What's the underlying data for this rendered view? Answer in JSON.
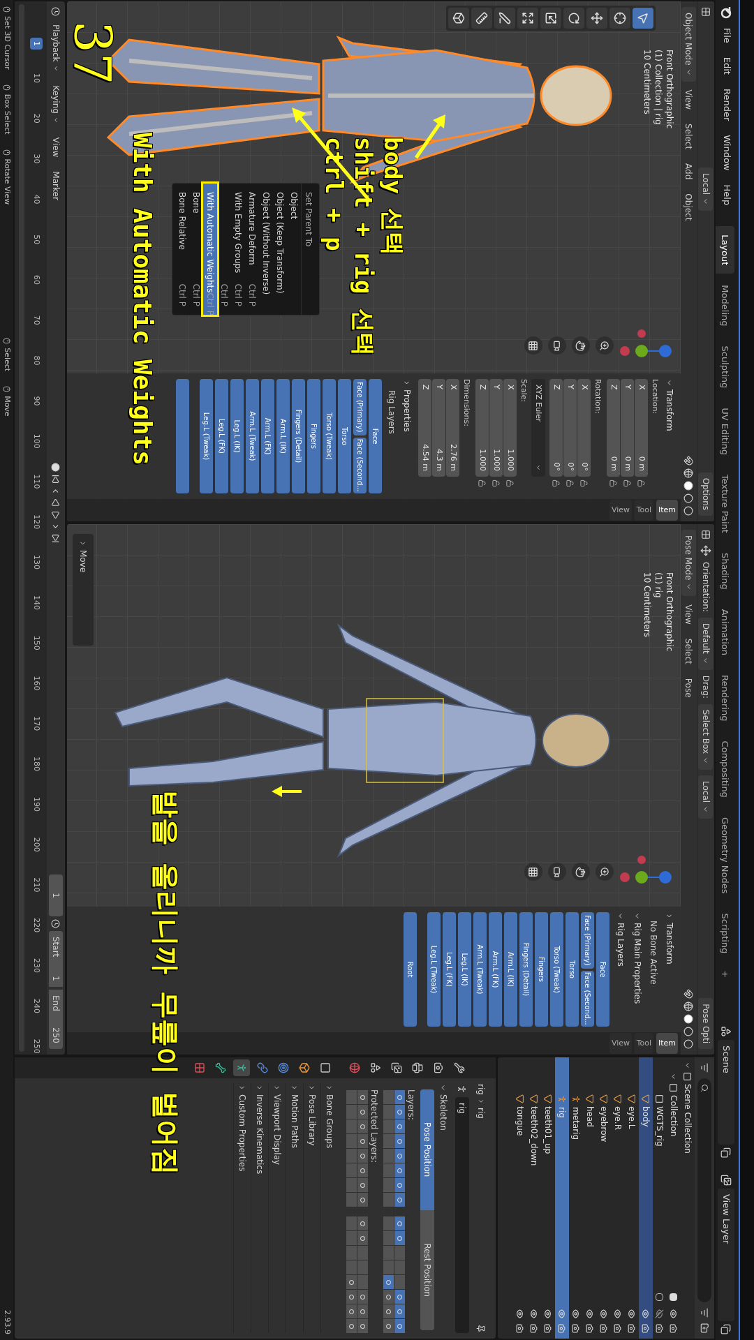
{
  "topbar": {
    "menus": [
      "File",
      "Edit",
      "Render",
      "Window",
      "Help"
    ],
    "workspaces": [
      {
        "label": "Layout",
        "selected": true
      },
      {
        "label": "Modeling",
        "selected": false
      },
      {
        "label": "Sculpting",
        "selected": false
      },
      {
        "label": "UV Editing",
        "selected": false
      },
      {
        "label": "Texture Paint",
        "selected": false
      },
      {
        "label": "Shading",
        "selected": false
      },
      {
        "label": "Animation",
        "selected": false
      },
      {
        "label": "Rendering",
        "selected": false
      },
      {
        "label": "Compositing",
        "selected": false
      },
      {
        "label": "Geometry Nodes",
        "selected": false
      },
      {
        "label": "Scripting",
        "selected": false
      }
    ],
    "add_workspace": "+",
    "scene": "Scene",
    "view_layer": "View Layer"
  },
  "viewports": [
    {
      "kind": "object",
      "tool_header": [
        {
          "kind": "dropdown",
          "text": "Local"
        },
        {
          "kind": "options",
          "text": "Options"
        }
      ],
      "mode": "Object Mode",
      "menus": [
        "View",
        "Select",
        "Add",
        "Object"
      ],
      "overlay": [
        "Front Orthographic",
        "(1) Collection | rig",
        "10 Centimeters"
      ],
      "toolbar": [
        {
          "kind": "select",
          "selected": true
        },
        {
          "kind": "cursor",
          "selected": false
        },
        {
          "kind": "move",
          "selected": false
        },
        {
          "kind": "rotate",
          "selected": false
        },
        {
          "kind": "scale",
          "selected": false
        },
        {
          "kind": "transform",
          "selected": false
        },
        {
          "kind": "annotate",
          "selected": false
        },
        {
          "kind": "measure",
          "selected": false
        },
        {
          "kind": "add_cube",
          "selected": false
        }
      ],
      "sidebar": {
        "tabs": [
          {
            "label": "View",
            "selected": false
          },
          {
            "label": "Tool",
            "selected": false
          },
          {
            "label": "Item",
            "selected": true
          }
        ],
        "sections": [
          {
            "kind": "header",
            "label": "Transform",
            "expanded": true
          },
          {
            "kind": "vector",
            "label": "Location:",
            "locks": true,
            "fields": [
              {
                "axis": "X",
                "value": "0 m"
              },
              {
                "axis": "Y",
                "value": "0 m"
              },
              {
                "axis": "Z",
                "value": "0 m"
              }
            ]
          },
          {
            "kind": "vector",
            "label": "Rotation:",
            "locks": true,
            "fields": [
              {
                "axis": "X",
                "value": "0°"
              },
              {
                "axis": "Y",
                "value": "0°"
              },
              {
                "axis": "Z",
                "value": "0°"
              }
            ]
          },
          {
            "kind": "dropdown",
            "value": "XYZ Euler"
          },
          {
            "kind": "vector",
            "label": "Scale:",
            "locks": true,
            "fields": [
              {
                "axis": "X",
                "value": "1.000"
              },
              {
                "axis": "Y",
                "value": "1.000"
              },
              {
                "axis": "Z",
                "value": "1.000"
              }
            ]
          },
          {
            "kind": "vector",
            "label": "Dimensions:",
            "locks": false,
            "fields": [
              {
                "axis": "X",
                "value": "2.76 m"
              },
              {
                "axis": "Y",
                "value": "4.3 m"
              },
              {
                "axis": "Z",
                "value": "4.54 m"
              }
            ]
          },
          {
            "kind": "header",
            "label": "Properties",
            "expanded": false
          },
          {
            "kind": "subheader",
            "label": "Rig Layers"
          },
          {
            "kind": "layers",
            "buttons": [
              {
                "label": "Face",
                "on": true,
                "half": false
              },
              {
                "label": "Face (Primary)",
                "on": true,
                "half": true
              },
              {
                "label": "Face (Second...",
                "on": true,
                "half": true
              },
              {
                "label": "Torso",
                "on": true,
                "half": false
              },
              {
                "label": "Torso (Tweak)",
                "on": true,
                "half": false
              },
              {
                "label": "Fingers",
                "on": true,
                "half": false
              },
              {
                "label": "Fingers (Detail)",
                "on": true,
                "half": false
              },
              {
                "label": "Arm.L (IK)",
                "on": true,
                "half": false
              },
              {
                "label": "Arm.L (FK)",
                "on": true,
                "half": false
              },
              {
                "label": "Arm.L (Tweak)",
                "on": true,
                "half": false
              },
              {
                "label": "Leg.L (IK)",
                "on": true,
                "half": false
              },
              {
                "label": "Leg.L (FK)",
                "on": true,
                "half": false
              },
              {
                "label": "Leg.L (Tweak)",
                "on": true,
                "half": false
              },
              {
                "on": true,
                "half": false
              }
            ]
          }
        ]
      }
    },
    {
      "kind": "pose",
      "tool_header": [
        {
          "kind": "label",
          "text": "Orientation:"
        },
        {
          "kind": "dropdown",
          "text": "Default"
        },
        {
          "kind": "label",
          "text": "Drag:"
        },
        {
          "kind": "dropdown",
          "text": "Select Box"
        },
        {
          "kind": "dropdown",
          "text": "Local"
        },
        {
          "kind": "options",
          "text": "Pose Opti"
        }
      ],
      "mode": "Pose Mode",
      "menus": [
        "View",
        "Select",
        "Pose"
      ],
      "overlay": [
        "Front Orthographic",
        "(1) rig",
        "10 Centimeters"
      ],
      "redo_panel": "Move",
      "sidebar": {
        "tabs": [
          {
            "label": "View",
            "selected": false
          },
          {
            "label": "Tool",
            "selected": false
          },
          {
            "label": "Item",
            "selected": true
          }
        ],
        "sections": [
          {
            "kind": "header",
            "label": "Transform",
            "expanded": false
          },
          {
            "kind": "text",
            "label": "No Bone Active"
          },
          {
            "kind": "header",
            "label": "Rig Main Properties",
            "expanded": true
          },
          {
            "kind": "header",
            "label": "Rig Layers",
            "expanded": true
          },
          {
            "kind": "layers",
            "buttons": [
              {
                "label": "Face",
                "on": true,
                "half": false
              },
              {
                "label": "Face (Primary)",
                "on": true,
                "half": true
              },
              {
                "label": "Face (Second...",
                "on": true,
                "half": true
              },
              {
                "label": "Torso",
                "on": true,
                "half": false
              },
              {
                "label": "Torso (Tweak)",
                "on": true,
                "half": false
              },
              {
                "label": "Fingers",
                "on": true,
                "half": false
              },
              {
                "label": "Fingers (Detail)",
                "on": true,
                "half": false
              },
              {
                "label": "Arm.L (IK)",
                "on": true,
                "half": false
              },
              {
                "label": "Arm.L (FK)",
                "on": true,
                "half": false
              },
              {
                "label": "Arm.L (Tweak)",
                "on": true,
                "half": false
              },
              {
                "label": "Leg.L (IK)",
                "on": true,
                "half": false
              },
              {
                "label": "Leg.L (FK)",
                "on": true,
                "half": false
              },
              {
                "label": "Leg.L (Tweak)",
                "on": true,
                "half": false
              },
              {
                "label": "Root",
                "on": true,
                "half": false
              }
            ]
          }
        ]
      }
    }
  ],
  "parent_menu": {
    "title": "Set Parent To",
    "items": [
      {
        "label": "Object",
        "selected": false
      },
      {
        "label": "Object (Keep Transform)",
        "selected": false
      },
      {
        "label": "Object (Without Inverse)",
        "selected": false
      },
      {
        "label": "Armature Deform",
        "shortcut": "Ctrl P",
        "selected": false
      },
      {
        "label": "With Empty Groups",
        "shortcut": "Ctrl P",
        "selected": false
      },
      {
        "shortcut": "Ctrl P",
        "selected": false
      },
      {
        "label": "With Automatic Weights",
        "shortcut": "Ctrl P",
        "selected": true,
        "outlined": true
      },
      {
        "label": "Bone",
        "shortcut": "Ctrl P",
        "selected": false
      },
      {
        "label": "Bone Relative",
        "shortcut": "Ctrl P",
        "selected": false
      }
    ]
  },
  "outliner": {
    "tree": [
      {
        "name": "Scene Collection",
        "kind": "scene_collection",
        "expanded": true,
        "selected": false,
        "children": [
          {
            "name": "Collection",
            "kind": "collection",
            "expanded": true,
            "checked": true,
            "visible": true,
            "selected": false,
            "children": [
              {
                "name": "WGTS_rig",
                "kind": "collection",
                "checked": false,
                "visible": false,
                "selected": false
              },
              {
                "name": "body",
                "kind": "mesh",
                "visible": true,
                "selected": true,
                "active": false
              },
              {
                "name": "eye.L",
                "kind": "mesh",
                "visible": true,
                "selected": false,
                "active": false
              },
              {
                "name": "eye.R",
                "kind": "mesh",
                "visible": true,
                "selected": false,
                "active": false
              },
              {
                "name": "eyebrow",
                "kind": "mesh",
                "visible": true,
                "selected": false,
                "active": false
              },
              {
                "name": "head",
                "kind": "mesh",
                "visible": true,
                "selected": false,
                "active": false
              },
              {
                "name": "metarig",
                "kind": "armature",
                "visible": true,
                "selected": false,
                "active": false
              },
              {
                "name": "rig",
                "kind": "armature",
                "visible": true,
                "selected": true,
                "active": true
              },
              {
                "name": "teeth01_up",
                "kind": "mesh",
                "visible": true,
                "selected": false,
                "active": false
              },
              {
                "name": "teeth02_down",
                "kind": "mesh",
                "visible": true,
                "selected": false,
                "active": false
              },
              {
                "name": "tongue",
                "kind": "mesh",
                "visible": true,
                "selected": false,
                "active": false
              }
            ]
          }
        ]
      }
    ]
  },
  "properties": {
    "tabs": [
      {
        "kind": "tool",
        "selected": false
      },
      {
        "kind": "render",
        "selected": false
      },
      {
        "kind": "output",
        "selected": false
      },
      {
        "kind": "view_layer",
        "selected": false
      },
      {
        "kind": "scene",
        "selected": false
      },
      {
        "kind": "world",
        "selected": false
      },
      {
        "kind": "collection",
        "selected": false
      },
      {
        "kind": "object",
        "selected": false
      },
      {
        "kind": "physics",
        "selected": false
      },
      {
        "kind": "constraints",
        "selected": false
      },
      {
        "kind": "armature",
        "selected": true
      },
      {
        "kind": "bone",
        "selected": false
      },
      {
        "kind": "texture",
        "selected": false
      }
    ],
    "breadcrumb": [
      "rig",
      "rig"
    ],
    "name": "rig",
    "skeleton": {
      "title": "Skeleton",
      "expanded": true,
      "positions": [
        {
          "label": "Pose Position",
          "selected": true
        },
        {
          "label": "Rest Position",
          "selected": false
        }
      ],
      "layers": {
        "label": "Layers:",
        "rows": [
          [
            {
              "on": true,
              "used": true
            },
            {
              "on": true,
              "used": true
            },
            {
              "on": true,
              "used": true
            },
            {
              "on": true,
              "used": true
            },
            {
              "on": true,
              "used": true
            },
            {
              "on": true,
              "used": true
            },
            {
              "on": true,
              "used": true
            },
            {
              "on": true,
              "used": true
            },
            {
              "on": true,
              "used": true
            },
            {
              "on": true,
              "used": true
            },
            {
              "on": false,
              "used": false
            },
            {
              "on": false,
              "used": false
            },
            {
              "on": false,
              "used": false
            },
            {
              "on": true,
              "used": true
            },
            {
              "on": true,
              "used": true
            },
            {
              "on": true,
              "used": true
            }
          ],
          [
            {
              "on": false,
              "used": false
            },
            {
              "on": false,
              "used": false
            },
            {
              "on": false,
              "used": false
            },
            {
              "on": false,
              "used": false
            },
            {
              "on": false,
              "used": false
            },
            {
              "on": false,
              "used": false
            },
            {
              "on": false,
              "used": false
            },
            {
              "on": false,
              "used": false
            },
            {
              "on": false,
              "used": false
            },
            {
              "on": false,
              "used": false
            },
            {
              "on": false,
              "used": false
            },
            {
              "on": false,
              "used": false
            },
            {
              "on": true,
              "used": true
            },
            {
              "on": false,
              "used": true
            },
            {
              "on": false,
              "used": true
            },
            {
              "on": false,
              "used": true
            }
          ]
        ]
      },
      "protected": {
        "label": "Protected Layers:",
        "rows": [
          [
            {
              "on": false,
              "used": true
            },
            {
              "on": false,
              "used": true
            },
            {
              "on": false,
              "used": true
            },
            {
              "on": false,
              "used": true
            },
            {
              "on": false,
              "used": true
            },
            {
              "on": false,
              "used": true
            },
            {
              "on": false,
              "used": true
            },
            {
              "on": false,
              "used": true
            },
            {
              "on": false,
              "used": true
            },
            {
              "on": false,
              "used": true
            },
            {
              "on": false,
              "used": false
            },
            {
              "on": false,
              "used": false
            },
            {
              "on": false,
              "used": false
            },
            {
              "on": false,
              "used": true
            },
            {
              "on": false,
              "used": true
            },
            {
              "on": false,
              "used": true
            }
          ],
          [
            {
              "on": false,
              "used": false
            },
            {
              "on": false,
              "used": false
            },
            {
              "on": false,
              "used": false
            },
            {
              "on": false,
              "used": false
            },
            {
              "on": false,
              "used": false
            },
            {
              "on": false,
              "used": false
            },
            {
              "on": false,
              "used": false
            },
            {
              "on": false,
              "used": false
            },
            {
              "on": false,
              "used": false
            },
            {
              "on": false,
              "used": false
            },
            {
              "on": false,
              "used": false
            },
            {
              "on": false,
              "used": false
            },
            {
              "on": false,
              "used": true
            },
            {
              "on": false,
              "used": true
            },
            {
              "on": false,
              "used": true
            },
            {
              "on": false,
              "used": true
            }
          ]
        ]
      }
    },
    "sections": [
      {
        "label": "Bone Groups",
        "expanded": false
      },
      {
        "label": "Pose Library",
        "expanded": false
      },
      {
        "label": "Motion Paths",
        "expanded": false
      },
      {
        "label": "Viewport Display",
        "expanded": false
      },
      {
        "label": "Inverse Kinematics",
        "expanded": false
      },
      {
        "label": "Custom Properties",
        "expanded": false
      }
    ]
  },
  "timeline": {
    "menus": [
      "Playback",
      "Keying",
      "View",
      "Marker"
    ],
    "current_frame": "1",
    "start_label": "Start",
    "start": "1",
    "end_label": "End",
    "end": "250",
    "playhead": "1",
    "frames": [
      "10",
      "20",
      "30",
      "40",
      "50",
      "60",
      "70",
      "80",
      "90",
      "100",
      "110",
      "120",
      "130",
      "140",
      "150",
      "160",
      "170",
      "180",
      "190",
      "200",
      "210",
      "220",
      "230",
      "240",
      "250"
    ]
  },
  "status_bar": {
    "items": [
      {
        "label": "Set 3D Cursor"
      },
      {
        "label": "Box Select"
      },
      {
        "label": "Rotate View"
      },
      {
        "label": "Select"
      },
      {
        "label": "Move"
      }
    ],
    "version": "2.93.9"
  },
  "annotations": [
    {
      "kind": "step",
      "text": "37"
    },
    {
      "kind": "note",
      "text": "body 선택"
    },
    {
      "kind": "note",
      "text": "shift + rig 선택"
    },
    {
      "kind": "note",
      "text": "ctrl + p"
    },
    {
      "kind": "note",
      "text": "With Automatic Weights"
    },
    {
      "kind": "note",
      "text": "발을 올리니까 무릎이 벌어짐"
    }
  ]
}
